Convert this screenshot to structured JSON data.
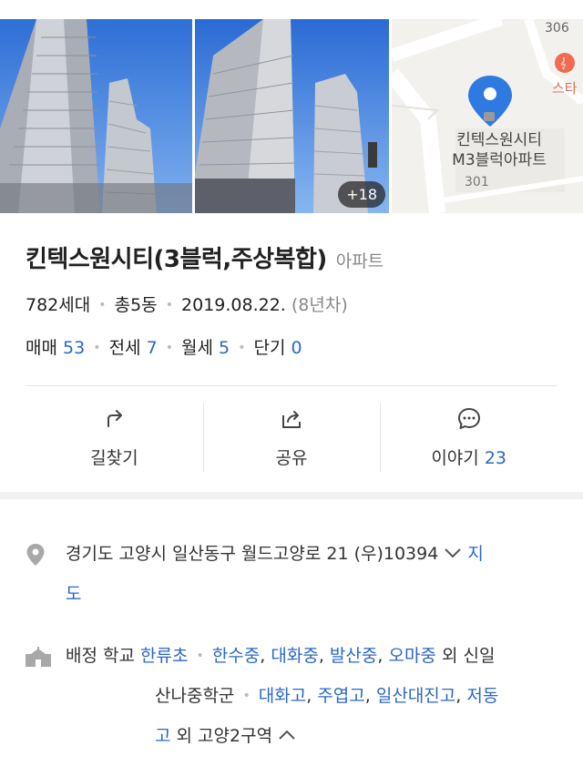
{
  "photos": {
    "more_count": "+18",
    "map": {
      "road_number": "306",
      "poi_label": "스타",
      "building_label_line1": "킨텍스원시티",
      "building_label_line2": "M3블럭아파트",
      "address_number": "301"
    }
  },
  "header": {
    "title": "킨텍스원시티(3블럭,주상복합)",
    "category": "아파트"
  },
  "meta": {
    "households": "782세대",
    "buildings": "총5동",
    "date": "2019.08.22.",
    "age": "(8년차)"
  },
  "deals": [
    {
      "label": "매매",
      "count": "53"
    },
    {
      "label": "전세",
      "count": "7"
    },
    {
      "label": "월세",
      "count": "5"
    },
    {
      "label": "단기",
      "count": "0"
    }
  ],
  "actions": {
    "directions": "길찾기",
    "share": "공유",
    "talk": "이야기",
    "talk_count": "23"
  },
  "address": {
    "text": "경기도 고양시 일산동구 월드고양로 21 (우)10394",
    "map_link_1": "지",
    "map_link_2": "도"
  },
  "school": {
    "label": "배정 학교",
    "elementary": "한류초",
    "middle": [
      "한수중",
      "대화중",
      "발산중",
      "오마중"
    ],
    "middle_more": "외 신일",
    "middle_group": "산나중학군",
    "high": [
      "대화고",
      "주엽고",
      "일산대진고",
      "저동"
    ],
    "high_last": "고",
    "high_more": "외 고양2구역"
  },
  "colors": {
    "link": "#2b68c4",
    "pin": "#2f7ae0",
    "muted": "#888888"
  }
}
